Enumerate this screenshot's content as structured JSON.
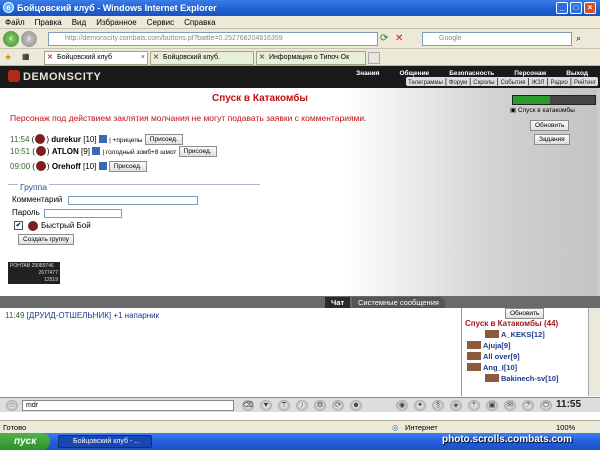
{
  "window": {
    "title": "Бойцовский клуб - Windows Internet Explorer"
  },
  "menu": [
    "Файл",
    "Правка",
    "Вид",
    "Избранное",
    "Сервис",
    "Справка"
  ],
  "address": {
    "url": "http://demonscity.combats.com/buttons.pl?battle=0.252768204816359"
  },
  "search": {
    "placeholder": "Google"
  },
  "tabs": [
    "Бойцовский клуб",
    "Бойцовский клуб.",
    "Информация о Типоч Ок"
  ],
  "game": {
    "logo": "DEMONSCITY",
    "nav_main": [
      "Знания",
      "Общение",
      "Безопасность",
      "Персонаж",
      "Выход"
    ],
    "nav_sub": [
      "Телеграммы",
      "Форум",
      "Скролы",
      "События",
      "ЖЗЛ",
      "Радио",
      "Рейтинг"
    ]
  },
  "page": {
    "title": "Спуск в Катакомбы",
    "warning": "Персонаж под действием заклятия молчания не могут подавать заявки с комментариями.",
    "requests": [
      {
        "time": "11:54",
        "nick": "durekur",
        "level": "[10]",
        "comment": "| +прицепы",
        "join": "Присоед."
      },
      {
        "time": "10:51",
        "nick": "ATLON",
        "level": "[9]",
        "comment": "| голодный зомб+8 шмот",
        "join": "Присоед."
      },
      {
        "time": "09:00",
        "nick": "Orehoff",
        "level": "[10]",
        "comment": "",
        "join": "Присоед."
      }
    ],
    "group": {
      "legend": "Группа",
      "comment_label": "Комментарий",
      "password_label": "Пароль",
      "quick_fight": "Быстрый Бой",
      "create_button": "Создать группу"
    },
    "right": {
      "descent_label": "Спуск в катакомбы",
      "refresh": "Обновить",
      "tasks": "Задания"
    },
    "counter": {
      "line1": "POHTAB 29089746",
      "line2": "2677477",
      "line3": "12519"
    }
  },
  "chat": {
    "tabs": [
      "Чат",
      "Системные сообщения"
    ],
    "message": {
      "time": "11:49",
      "name": "[ДРУИД-ОТШЕЛЬНИК]",
      "text": "+1 напарник"
    },
    "input_value": "mdr"
  },
  "sidebar": {
    "refresh": "Обновить",
    "title": "Спуск в Катакомбы (44)",
    "players": [
      {
        "nick": "A_KEKS",
        "level": "[12]"
      },
      {
        "nick": "Ajuja",
        "level": "[9]"
      },
      {
        "nick": "All over",
        "level": "[9]"
      },
      {
        "nick": "Ang_I",
        "level": "[10]"
      },
      {
        "nick": "Bakinech-sv",
        "level": "[10]"
      }
    ]
  },
  "clock": "11:55",
  "status": {
    "left": "Готово",
    "zone": "Интернет",
    "zoom": "100%"
  },
  "taskbar": {
    "start": "пуск",
    "window": "Бойцовский клуб - ..."
  },
  "watermark": "photo.scrolls.combats.com",
  "colors": {
    "accent": "#c01010",
    "link": "#1a3a8a",
    "titlebar": "#1f5fd0"
  }
}
